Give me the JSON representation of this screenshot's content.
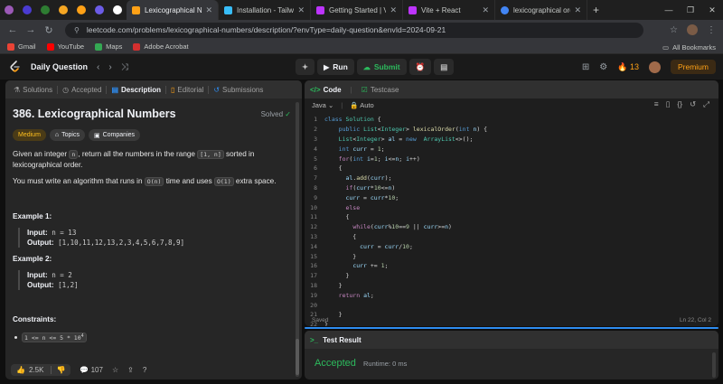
{
  "browser": {
    "tabs": [
      {
        "title": "Lexicographical Numbers",
        "color": "#ffa116",
        "active": true
      },
      {
        "title": "Installation - Tailwind CSS",
        "color": "#38bdf8",
        "active": false
      },
      {
        "title": "Getting Started | Vite",
        "color": "#bd34fe",
        "active": false
      },
      {
        "title": "Vite + React",
        "color": "#bd34fe",
        "active": false
      },
      {
        "title": "lexicographical order in",
        "color": "#4285f4",
        "active": false
      }
    ],
    "pinned_colors": [
      "#9b59b6",
      "#4a3bd1",
      "#2e7d32",
      "#f5a623",
      "#ffa116",
      "#6c5ce7",
      "#ffffff"
    ],
    "url": "leetcode.com/problems/lexicographical-numbers/description/?envType=daily-question&envId=2024-09-21",
    "bookmarks": [
      {
        "label": "Gmail",
        "color": "#ea4335"
      },
      {
        "label": "YouTube",
        "color": "#ff0000"
      },
      {
        "label": "Maps",
        "color": "#34a853"
      },
      {
        "label": "Adobe Acrobat",
        "color": "#d32f2f"
      }
    ],
    "all_bookmarks": "All Bookmarks"
  },
  "lc": {
    "daily_question": "Daily Question",
    "run": "Run",
    "submit": "Submit",
    "streak": "13",
    "premium": "Premium"
  },
  "left": {
    "tabs": [
      "Solutions",
      "Accepted",
      "Description",
      "Editorial",
      "Submissions"
    ],
    "title": "386. Lexicographical Numbers",
    "solved": "Solved",
    "tags": [
      "Medium",
      "Topics",
      "Companies"
    ],
    "desc1_a": "Given an integer ",
    "desc1_n": "n",
    "desc1_b": ", return all the numbers in the range ",
    "desc1_range": "[1, n]",
    "desc1_c": " sorted in lexicographical order.",
    "desc2_a": "You must write an algorithm that runs in ",
    "desc2_on": "O(n)",
    "desc2_b": " time and uses ",
    "desc2_o1": "O(1)",
    "desc2_c": " extra space.",
    "ex1_head": "Example 1:",
    "ex1_input_label": "Input:",
    "ex1_input": " n = 13",
    "ex1_output_label": "Output:",
    "ex1_output": " [1,10,11,12,13,2,3,4,5,6,7,8,9]",
    "ex2_head": "Example 2:",
    "ex2_input_label": "Input:",
    "ex2_input": " n = 2",
    "ex2_output_label": "Output:",
    "ex2_output": " [1,2]",
    "constraints_head": "Constraints:",
    "constraint": "1 <= n <= 5 * 10",
    "constraint_exp": "4",
    "likes": "2.5K",
    "comments": "107"
  },
  "editor": {
    "tabs": [
      "Code",
      "Testcase"
    ],
    "language": "Java",
    "mode": "Auto",
    "status": "Saved",
    "cursor": "Ln 22, Col 2",
    "lines": [
      "class Solution {",
      "    public List<Integer> lexicalOrder(int n) {",
      "    List<Integer> al = new  ArrayList<>();",
      "    int curr = 1;",
      "    for(int i=1; i<=n; i++)",
      "    {",
      "      al.add(curr);",
      "      if(curr*10<=n)",
      "      curr = curr*10;",
      "      else",
      "      {",
      "        while(curr%10==9 || curr>=n)",
      "        {",
      "          curr = curr/10;",
      "        }",
      "        curr += 1;",
      "      }",
      "    }",
      "    return al;",
      "",
      "    }",
      "}"
    ]
  },
  "result": {
    "tab": "Test Result",
    "status": "Accepted",
    "runtime": "Runtime: 0 ms"
  }
}
